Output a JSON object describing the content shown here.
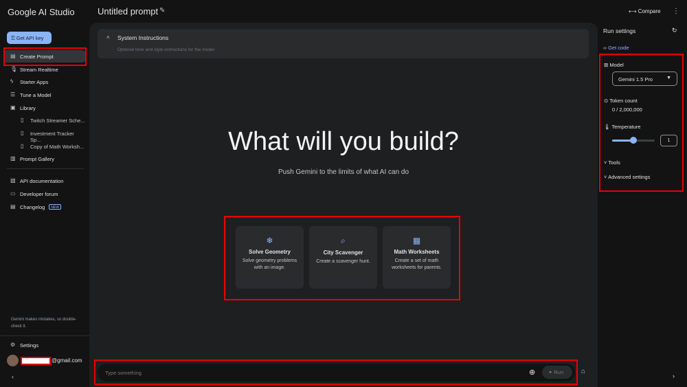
{
  "app": {
    "name": "Google AI Studio",
    "prompt_title": "Untitled prompt",
    "compare": "Compare"
  },
  "sidebar": {
    "api_key": "Get API key",
    "items": [
      {
        "label": "Create Prompt",
        "icon": "create-prompt-icon"
      },
      {
        "label": "Stream Realtime",
        "icon": "mic-icon"
      },
      {
        "label": "Starter Apps",
        "icon": "bolt-icon"
      },
      {
        "label": "Tune a Model",
        "icon": "tune-icon"
      },
      {
        "label": "Library",
        "icon": "library-icon"
      }
    ],
    "library": [
      "Twitch Streamer Sche...",
      "Investment Tracker Sp...",
      "Copy of Math Worksh..."
    ],
    "gallery": "Prompt Gallery",
    "links": [
      {
        "label": "API documentation"
      },
      {
        "label": "Developer forum"
      },
      {
        "label": "Changelog",
        "badge": "NEW"
      }
    ],
    "disclaimer": "Gemini makes mistakes, so double-check it.",
    "settings": "Settings",
    "email_suffix": "@gmail.com"
  },
  "main": {
    "system_title": "System Instructions",
    "system_placeholder": "Optional tone and style instructions for the model",
    "headline": "What will you build?",
    "subhead": "Push Gemini to the limits of what AI can do",
    "cards": [
      {
        "title": "Solve Geometry",
        "desc": "Solve geometry problems with an image."
      },
      {
        "title": "City Scavenger",
        "desc": "Create a scavenger hunt."
      },
      {
        "title": "Math Worksheets",
        "desc": "Create a set of math worksheets for parents."
      }
    ],
    "input_placeholder": "Type something",
    "run": "Run"
  },
  "run_settings": {
    "title": "Run settings",
    "get_code": "Get code",
    "model_label": "Model",
    "model": "Gemini 1.5 Pro",
    "token_label": "Token count",
    "token_value": "0 / 2,000,000",
    "temp_label": "Temperature",
    "temperature": "1",
    "temperature_fraction": 0.5,
    "tools": "Tools",
    "advanced": "Advanced settings"
  }
}
